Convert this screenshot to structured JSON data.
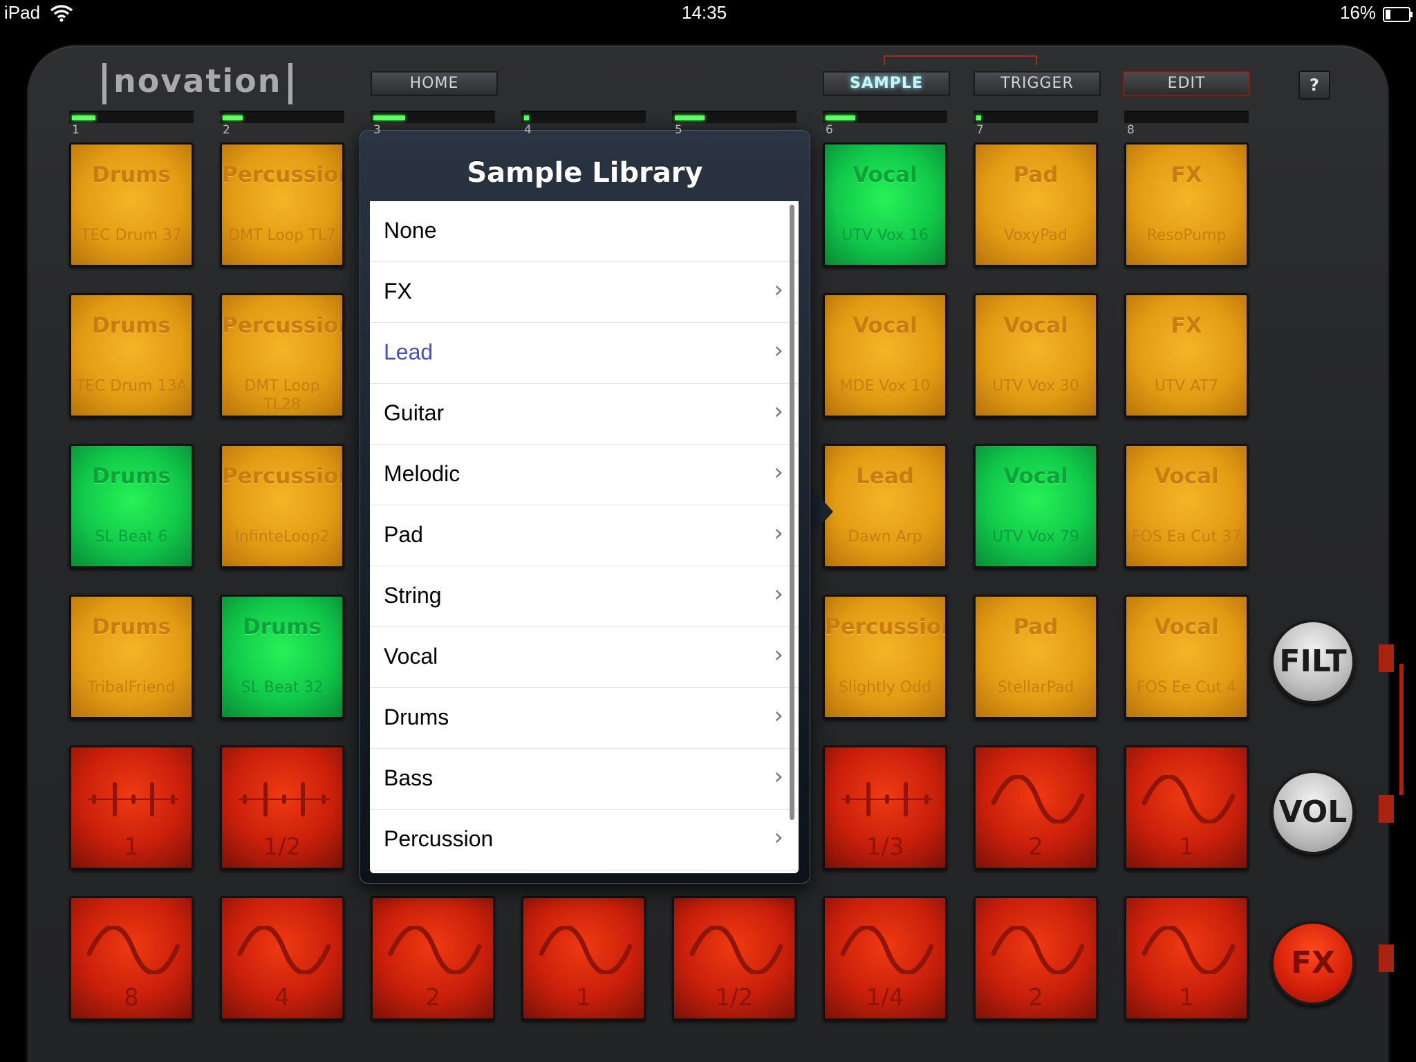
{
  "status_bar": {
    "device": "iPad",
    "time": "14:35",
    "battery": "16%"
  },
  "brand": {
    "logo": "novation"
  },
  "nav": {
    "home": "HOME",
    "sample": "SAMPLE",
    "trigger": "TRIGGER",
    "edit": "EDIT",
    "help": "?"
  },
  "channels": [
    {
      "number": "1",
      "level": 0.2
    },
    {
      "number": "2",
      "level": 0.17
    },
    {
      "number": "3",
      "level": 0.27
    },
    {
      "number": "4",
      "level": 0.04
    },
    {
      "number": "5",
      "level": 0.25
    },
    {
      "number": "6",
      "level": 0.25
    },
    {
      "number": "7",
      "level": 0.04
    },
    {
      "number": "8",
      "level": 0.0
    }
  ],
  "sample_pads": [
    [
      {
        "category": "Drums",
        "sample": "TEC Drum 37",
        "color": "orange"
      },
      {
        "category": "Percussion",
        "sample": "DMT Loop TL7",
        "color": "orange"
      },
      null,
      null,
      null,
      {
        "category": "Vocal",
        "sample": "UTV Vox 16",
        "color": "green"
      },
      {
        "category": "Pad",
        "sample": "VoxyPad",
        "color": "orange"
      },
      {
        "category": "FX",
        "sample": "ResoPump",
        "color": "orange"
      }
    ],
    [
      {
        "category": "Drums",
        "sample": "TEC Drum 13A",
        "color": "orange"
      },
      {
        "category": "Percussion",
        "sample": "DMT Loop TL28",
        "color": "orange"
      },
      null,
      null,
      null,
      {
        "category": "Vocal",
        "sample": "MDE Vox 10",
        "color": "orange"
      },
      {
        "category": "Vocal",
        "sample": "UTV Vox 30",
        "color": "orange"
      },
      {
        "category": "FX",
        "sample": "UTV AT7",
        "color": "orange"
      }
    ],
    [
      {
        "category": "Drums",
        "sample": "SL Beat 6",
        "color": "green"
      },
      {
        "category": "Percussion",
        "sample": "InfinteLoop2",
        "color": "orange"
      },
      null,
      null,
      null,
      {
        "category": "Lead",
        "sample": "Dawn Arp",
        "color": "orange"
      },
      {
        "category": "Vocal",
        "sample": "UTV Vox 79",
        "color": "green"
      },
      {
        "category": "Vocal",
        "sample": "FOS Ea Cut 37",
        "color": "orange"
      }
    ],
    [
      {
        "category": "Drums",
        "sample": "TribalFriend",
        "color": "orange"
      },
      {
        "category": "Drums",
        "sample": "SL Beat 32",
        "color": "green"
      },
      null,
      null,
      null,
      {
        "category": "Percussion",
        "sample": "Slightly Odd",
        "color": "orange"
      },
      {
        "category": "Pad",
        "sample": "StellarPad",
        "color": "orange"
      },
      {
        "category": "Vocal",
        "sample": "FOS Ee Cut 4",
        "color": "orange"
      }
    ]
  ],
  "effect_pads": [
    [
      {
        "value": "1",
        "icon": "gate-icon"
      },
      {
        "value": "1/2",
        "icon": "gate-icon"
      },
      null,
      null,
      null,
      {
        "value": "1/3",
        "icon": "gate-icon"
      },
      {
        "value": "2",
        "icon": "sine-wave-icon"
      },
      {
        "value": "1",
        "icon": "sine-wave-icon"
      }
    ],
    [
      {
        "value": "8",
        "icon": "sine-wave-icon"
      },
      {
        "value": "4",
        "icon": "sine-wave-icon"
      },
      {
        "value": "2",
        "icon": "sine-wave-icon"
      },
      {
        "value": "1",
        "icon": "sine-wave-icon"
      },
      {
        "value": "1/2",
        "icon": "sine-wave-icon"
      },
      {
        "value": "1/4",
        "icon": "sine-wave-icon"
      },
      {
        "value": "2",
        "icon": "sine-wave-icon"
      },
      {
        "value": "1",
        "icon": "sine-wave-icon"
      }
    ]
  ],
  "side_buttons": {
    "filter": "FILT",
    "volume": "VOL",
    "fx": "FX"
  },
  "sample_library": {
    "title": "Sample Library",
    "items": [
      {
        "label": "None",
        "has_submenu": false,
        "selected": false
      },
      {
        "label": "FX",
        "has_submenu": true,
        "selected": false
      },
      {
        "label": "Lead",
        "has_submenu": true,
        "selected": true
      },
      {
        "label": "Guitar",
        "has_submenu": true,
        "selected": false
      },
      {
        "label": "Melodic",
        "has_submenu": true,
        "selected": false
      },
      {
        "label": "Pad",
        "has_submenu": true,
        "selected": false
      },
      {
        "label": "String",
        "has_submenu": true,
        "selected": false
      },
      {
        "label": "Vocal",
        "has_submenu": true,
        "selected": false
      },
      {
        "label": "Drums",
        "has_submenu": true,
        "selected": false
      },
      {
        "label": "Bass",
        "has_submenu": true,
        "selected": false
      },
      {
        "label": "Percussion",
        "has_submenu": true,
        "selected": false
      }
    ],
    "chevron": "›"
  }
}
